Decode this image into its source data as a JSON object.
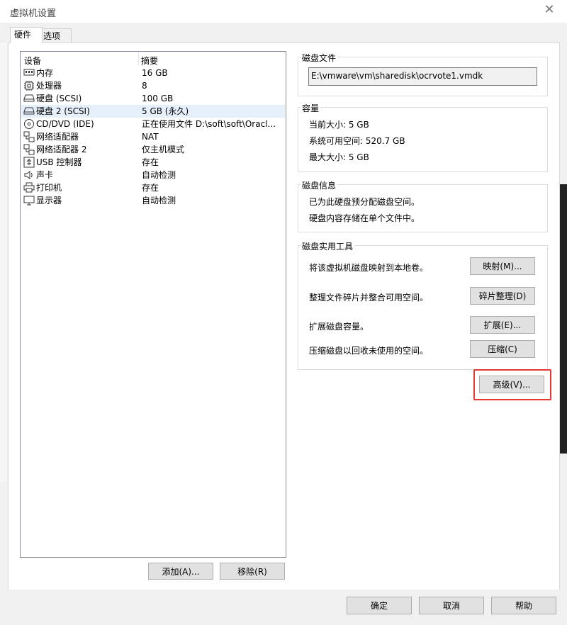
{
  "window": {
    "title": "虚拟机设置"
  },
  "tabs": [
    {
      "label": "硬件"
    },
    {
      "label": "选项"
    }
  ],
  "device_list": {
    "headers": {
      "device": "设备",
      "summary": "摘要"
    },
    "rows": [
      {
        "icon": "memory-icon",
        "name": "内存",
        "summary": "16 GB"
      },
      {
        "icon": "processor-icon",
        "name": "处理器",
        "summary": "8"
      },
      {
        "icon": "hard-disk-icon",
        "name": "硬盘 (SCSI)",
        "summary": "100 GB"
      },
      {
        "icon": "hard-disk-icon",
        "name": "硬盘 2 (SCSI)",
        "summary": "5 GB (永久)"
      },
      {
        "icon": "cd-dvd-icon",
        "name": "CD/DVD (IDE)",
        "summary": "正在使用文件 D:\\soft\\soft\\Oracl..."
      },
      {
        "icon": "network-adapter-icon",
        "name": "网络适配器",
        "summary": "NAT"
      },
      {
        "icon": "network-adapter-icon",
        "name": "网络适配器 2",
        "summary": "仅主机模式"
      },
      {
        "icon": "usb-icon",
        "name": "USB 控制器",
        "summary": "存在"
      },
      {
        "icon": "sound-card-icon",
        "name": "声卡",
        "summary": "自动检测"
      },
      {
        "icon": "printer-icon",
        "name": "打印机",
        "summary": "存在"
      },
      {
        "icon": "display-icon",
        "name": "显示器",
        "summary": "自动检测"
      }
    ],
    "selected_index": 3,
    "add_label": "添加(A)...",
    "remove_label": "移除(R)"
  },
  "disk_file": {
    "title": "磁盘文件",
    "path": "E:\\vmware\\vm\\sharedisk\\ocrvote1.vmdk"
  },
  "capacity": {
    "title": "容量",
    "current": "当前大小: 5 GB",
    "available": "系统可用空间: 520.7 GB",
    "max": "最大大小: 5 GB"
  },
  "disk_info": {
    "title": "磁盘信息",
    "line1": "已为此硬盘预分配磁盘空间。",
    "line2": "硬盘内容存储在单个文件中。"
  },
  "utilities": {
    "title": "磁盘实用工具",
    "map_desc": "将该虚拟机磁盘映射到本地卷。",
    "map_btn": "映射(M)...",
    "defrag_desc": "整理文件碎片并整合可用空间。",
    "defrag_btn": "碎片整理(D)",
    "expand_desc": "扩展磁盘容量。",
    "expand_btn": "扩展(E)...",
    "compact_desc": "压缩磁盘以回收未使用的空间。",
    "compact_btn": "压缩(C)"
  },
  "advanced_btn": "高级(V)...",
  "footer": {
    "ok": "确定",
    "cancel": "取消",
    "help": "帮助"
  },
  "colors": {
    "highlight": "#e53935",
    "selected_row": "#e5f0fb",
    "button_face": "#e1e1e1"
  }
}
